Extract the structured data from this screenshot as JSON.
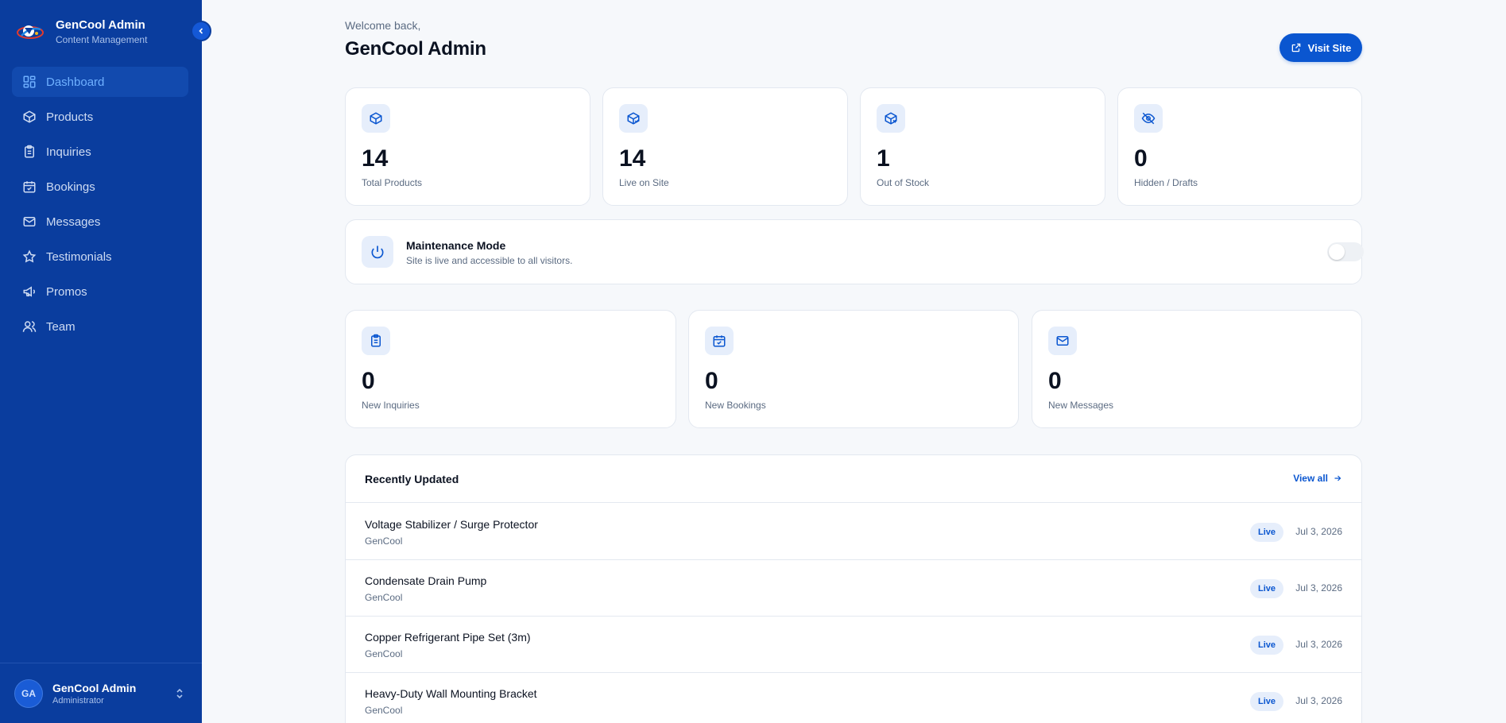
{
  "brand": {
    "title": "GenCool Admin",
    "subtitle": "Content Management"
  },
  "sidebar": {
    "items": [
      {
        "label": "Dashboard",
        "icon": "dashboard-icon",
        "active": true
      },
      {
        "label": "Products",
        "icon": "box-icon"
      },
      {
        "label": "Inquiries",
        "icon": "clipboard-icon"
      },
      {
        "label": "Bookings",
        "icon": "calendar-check-icon"
      },
      {
        "label": "Messages",
        "icon": "mail-icon"
      },
      {
        "label": "Testimonials",
        "icon": "star-icon"
      },
      {
        "label": "Promos",
        "icon": "megaphone-icon"
      },
      {
        "label": "Team",
        "icon": "users-icon"
      }
    ]
  },
  "user": {
    "initials": "GA",
    "name": "GenCool Admin",
    "role": "Administrator"
  },
  "header": {
    "welcome": "Welcome back,",
    "title": "GenCool Admin",
    "visit_label": "Visit Site"
  },
  "stats": [
    {
      "value": "14",
      "label": "Total Products",
      "icon": "box-icon"
    },
    {
      "value": "14",
      "label": "Live on Site",
      "icon": "box-check-icon"
    },
    {
      "value": "1",
      "label": "Out of Stock",
      "icon": "box-x-icon"
    },
    {
      "value": "0",
      "label": "Hidden / Drafts",
      "icon": "eye-off-icon"
    }
  ],
  "maintenance": {
    "title": "Maintenance Mode",
    "description": "Site is live and accessible to all visitors.",
    "enabled": false
  },
  "activity": [
    {
      "value": "0",
      "label": "New Inquiries",
      "icon": "clipboard-icon"
    },
    {
      "value": "0",
      "label": "New Bookings",
      "icon": "calendar-check-icon"
    },
    {
      "value": "0",
      "label": "New Messages",
      "icon": "mail-icon"
    }
  ],
  "recent": {
    "title": "Recently Updated",
    "view_all": "View all",
    "rows": [
      {
        "name": "Voltage Stabilizer / Surge Protector",
        "brand": "GenCool",
        "status": "Live",
        "date": "Jul 3, 2026"
      },
      {
        "name": "Condensate Drain Pump",
        "brand": "GenCool",
        "status": "Live",
        "date": "Jul 3, 2026"
      },
      {
        "name": "Copper Refrigerant Pipe Set (3m)",
        "brand": "GenCool",
        "status": "Live",
        "date": "Jul 3, 2026"
      },
      {
        "name": "Heavy-Duty Wall Mounting Bracket",
        "brand": "GenCool",
        "status": "Live",
        "date": "Jul 3, 2026"
      }
    ]
  },
  "colors": {
    "sidebar": "#0a3d9e",
    "accent": "#0a56d0",
    "background": "#f6f8fb"
  }
}
